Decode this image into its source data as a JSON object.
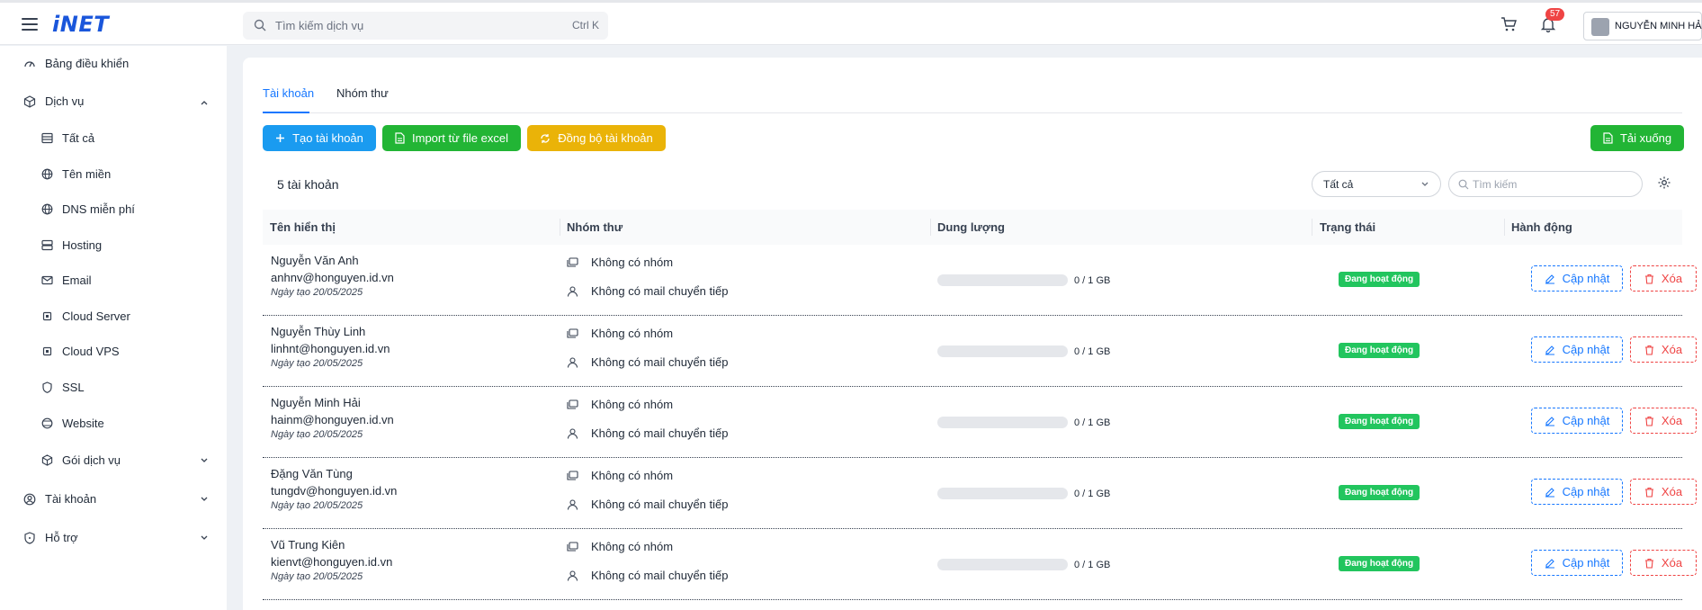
{
  "header": {
    "logo": "iNET",
    "search_placeholder": "Tìm kiếm dịch vụ",
    "search_shortcut": "Ctrl K",
    "notification_count": "57",
    "user_name": "NGUYỄN MINH HẢI"
  },
  "sidebar": {
    "items": [
      {
        "label": "Bảng điều khiển"
      },
      {
        "label": "Dịch vụ"
      },
      {
        "label": "Tất cả"
      },
      {
        "label": "Tên miền"
      },
      {
        "label": "DNS miễn phí"
      },
      {
        "label": "Hosting"
      },
      {
        "label": "Email"
      },
      {
        "label": "Cloud Server"
      },
      {
        "label": "Cloud VPS"
      },
      {
        "label": "SSL"
      },
      {
        "label": "Website"
      },
      {
        "label": "Gói dịch vụ"
      },
      {
        "label": "Tài khoản"
      },
      {
        "label": "Hỗ trợ"
      }
    ]
  },
  "tabs": [
    {
      "label": "Tài khoản"
    },
    {
      "label": "Nhóm thư"
    }
  ],
  "toolbar": {
    "create_label": "Tạo tài khoản",
    "import_label": "Import từ file excel",
    "sync_label": "Đồng bộ tài khoản",
    "download_label": "Tải xuống"
  },
  "filter": {
    "count_label": "5 tài khoản",
    "select_value": "Tất cả",
    "search_placeholder": "Tìm kiếm"
  },
  "table": {
    "columns": [
      "Tên hiển thị",
      "Nhóm thư",
      "Dung lượng",
      "Trạng thái",
      "Hành động"
    ],
    "update_label": "Cập nhật",
    "delete_label": "Xóa",
    "rows": [
      {
        "name": "Nguyễn Văn Anh",
        "email": "anhnv@honguyen.id.vn",
        "created": "Ngày tạo 20/05/2025",
        "group": "Không có nhóm",
        "forward": "Không có mail chuyển tiếp",
        "usage": 0,
        "quota": "0 / 1 GB",
        "status": "Đang hoạt động"
      },
      {
        "name": "Nguyễn Thùy Linh",
        "email": "linhnt@honguyen.id.vn",
        "created": "Ngày tạo 20/05/2025",
        "group": "Không có nhóm",
        "forward": "Không có mail chuyển tiếp",
        "usage": 0,
        "quota": "0 / 1 GB",
        "status": "Đang hoạt động"
      },
      {
        "name": "Nguyễn Minh Hải",
        "email": "hainm@honguyen.id.vn",
        "created": "Ngày tạo 20/05/2025",
        "group": "Không có nhóm",
        "forward": "Không có mail chuyển tiếp",
        "usage": 0,
        "quota": "0 / 1 GB",
        "status": "Đang hoạt động"
      },
      {
        "name": "Đặng Văn Tùng",
        "email": "tungdv@honguyen.id.vn",
        "created": "Ngày tạo 20/05/2025",
        "group": "Không có nhóm",
        "forward": "Không có mail chuyển tiếp",
        "usage": 0,
        "quota": "0 / 1 GB",
        "status": "Đang hoạt động"
      },
      {
        "name": "Vũ Trung Kiên",
        "email": "kienvt@honguyen.id.vn",
        "created": "Ngày tạo 20/05/2025",
        "group": "Không có nhóm",
        "forward": "Không có mail chuyển tiếp",
        "usage": 0,
        "quota": "0 / 1 GB",
        "status": "Đang hoạt động"
      }
    ]
  },
  "colors": {
    "primary": "#1677ff",
    "success": "#22c55e",
    "warning": "#eab308",
    "danger": "#ef4444"
  }
}
